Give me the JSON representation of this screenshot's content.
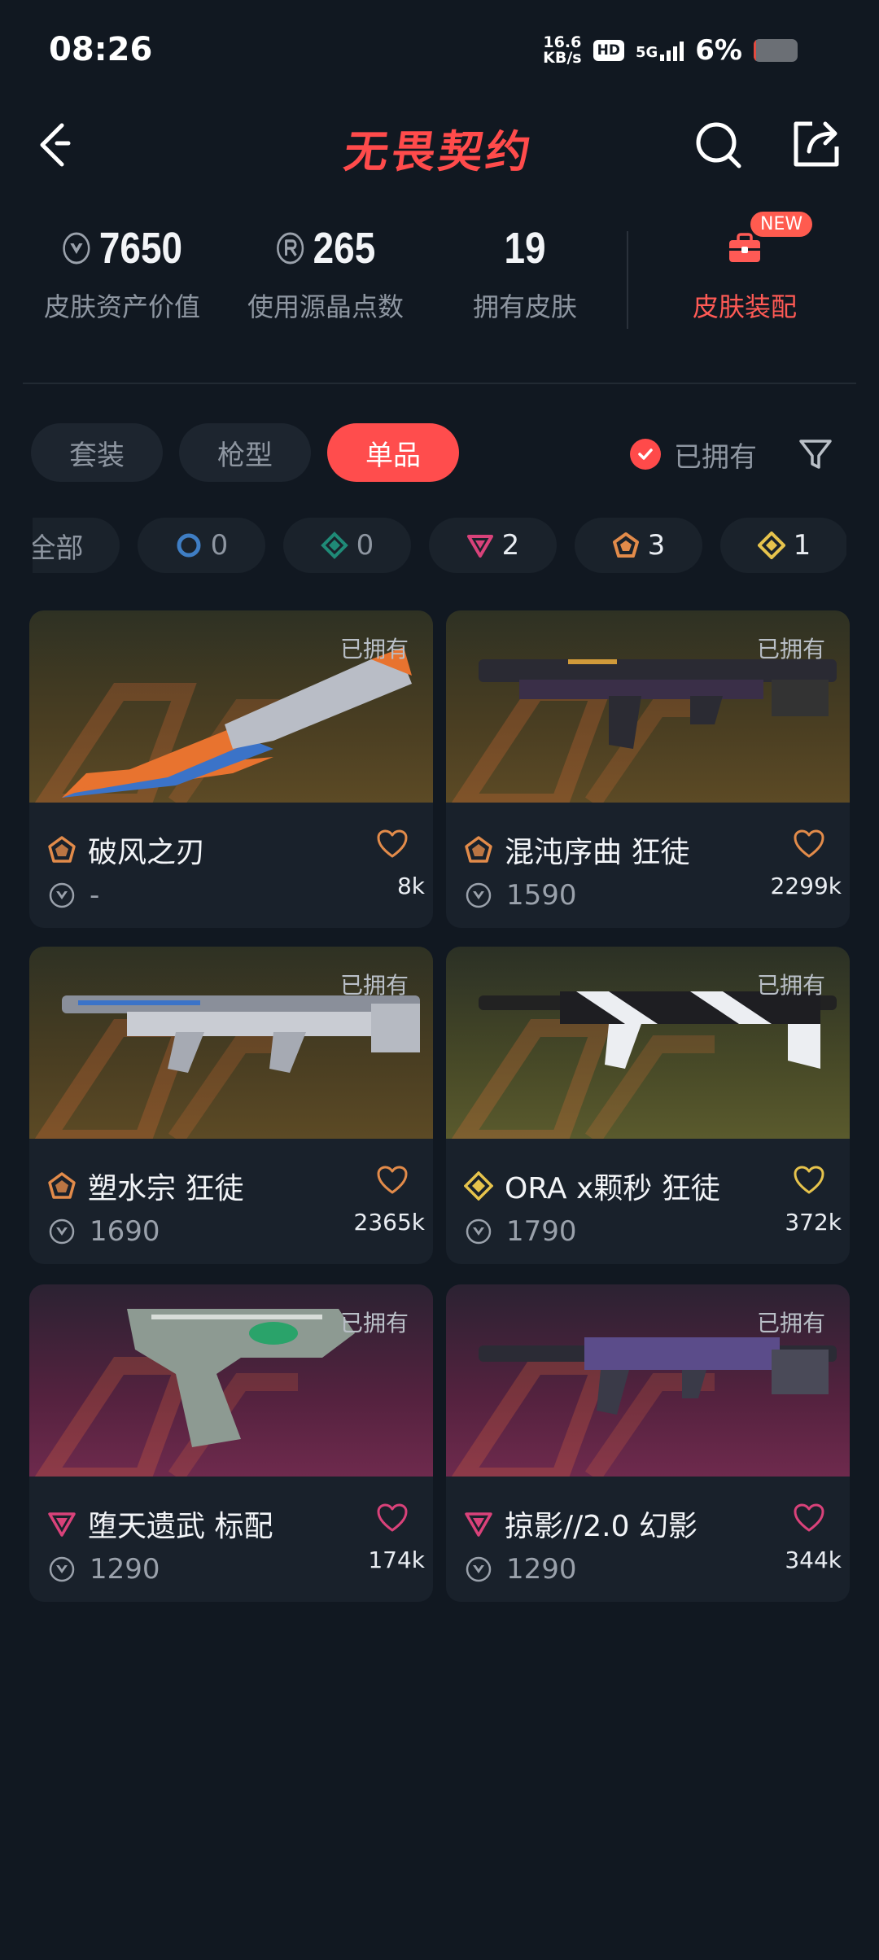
{
  "status": {
    "time": "08:26",
    "speed_top": "16.6",
    "speed_bottom": "KB/s",
    "hd": "HD",
    "network": "5G",
    "battery": "6%",
    "battery_level": 0.06
  },
  "header": {
    "title": "无畏契约",
    "back_icon": "chevron-left-icon",
    "search_icon": "search-icon",
    "share_icon": "share-icon"
  },
  "stats": [
    {
      "value": "7650",
      "label": "皮肤资产价值",
      "icon": "vp-icon"
    },
    {
      "value": "265",
      "label": "使用源晶点数",
      "icon": "radianite-icon"
    },
    {
      "value": "19",
      "label": "拥有皮肤",
      "icon": ""
    }
  ],
  "outfit": {
    "label": "皮肤装配",
    "badge": "NEW",
    "icon": "briefcase-icon"
  },
  "tabs": [
    {
      "label": "套装",
      "active": false
    },
    {
      "label": "枪型",
      "active": false
    },
    {
      "label": "单品",
      "active": true
    }
  ],
  "owned_filter": {
    "label": "已拥有",
    "checked": true
  },
  "tiers": [
    {
      "label": "全部",
      "count": ""
    },
    {
      "label": "",
      "count": "0",
      "tier": "select",
      "color": "#3f7ec4"
    },
    {
      "label": "",
      "count": "0",
      "tier": "deluxe",
      "color": "#1f8a77"
    },
    {
      "label": "",
      "count": "2",
      "tier": "premium",
      "color": "#d9427a"
    },
    {
      "label": "",
      "count": "3",
      "tier": "exclusive",
      "color": "#e28b4a"
    },
    {
      "label": "",
      "count": "1",
      "tier": "ultra",
      "color": "#e6c34c"
    }
  ],
  "skins": [
    {
      "name": "破风之刃",
      "tier": "exclusive",
      "price": "-",
      "likes": "8k",
      "owned": "已拥有",
      "bg": "gold",
      "heart_color": "#e28b4a"
    },
    {
      "name": "混沌序曲 狂徒",
      "tier": "exclusive",
      "price": "1590",
      "likes": "2299k",
      "owned": "已拥有",
      "bg": "gold",
      "heart_color": "#e28b4a"
    },
    {
      "name": "塑水宗 狂徒",
      "tier": "exclusive",
      "price": "1690",
      "likes": "2365k",
      "owned": "已拥有",
      "bg": "gold",
      "heart_color": "#e28b4a"
    },
    {
      "name": "ORA x颗秒 狂徒",
      "tier": "ultra",
      "price": "1790",
      "likes": "372k",
      "owned": "已拥有",
      "bg": "olive",
      "heart_color": "#e6c34c"
    },
    {
      "name": "堕天遗武 标配",
      "tier": "premium",
      "price": "1290",
      "likes": "174k",
      "owned": "已拥有",
      "bg": "purple",
      "heart_color": "#d9427a"
    },
    {
      "name": "掠影//2.0 幻影",
      "tier": "premium",
      "price": "1290",
      "likes": "344k",
      "owned": "已拥有",
      "bg": "purple",
      "heart_color": "#d9427a"
    }
  ]
}
